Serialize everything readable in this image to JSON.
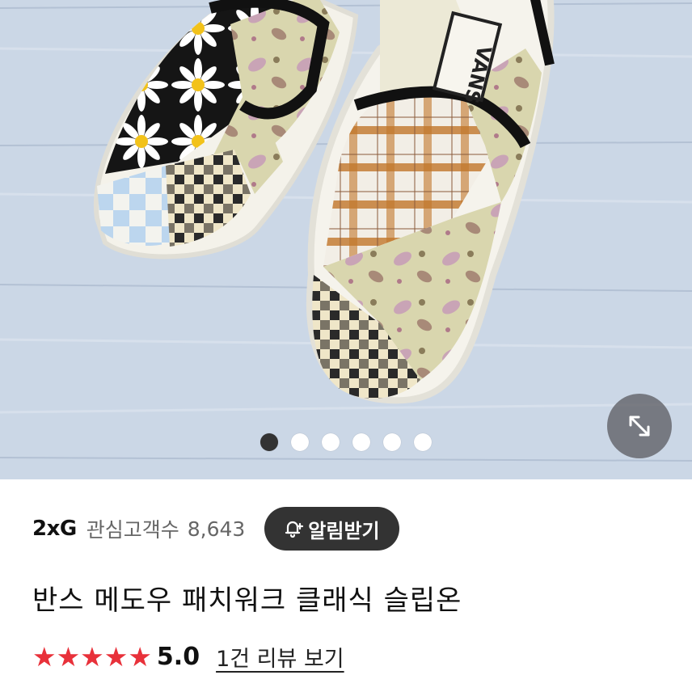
{
  "product_image": {
    "description_icon": "slip-on-patchwork-shoes",
    "carousel": {
      "total": 6,
      "active_index": 0
    }
  },
  "expand_button": {
    "icon": "expand-diagonal-icon"
  },
  "seller": {
    "brand": "2xG",
    "fans_label": "관심고객수",
    "fans_count": "8,643",
    "notify_label": "알림받기",
    "notify_icon": "bell-plus-icon"
  },
  "product": {
    "title": "반스 메도우 패치워크 클래식 슬립온"
  },
  "rating": {
    "stars": "★★★★★",
    "score": "5.0",
    "review_link": "1건 리뷰 보기",
    "star_color": "#e8313a"
  }
}
